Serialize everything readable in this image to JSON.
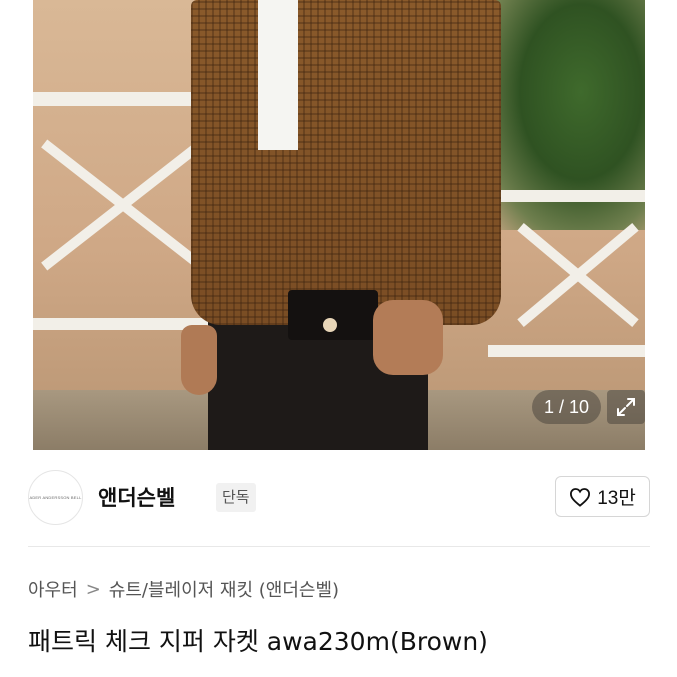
{
  "gallery": {
    "counter_text": "1 / 10",
    "expand_icon": "expand-arrows-icon"
  },
  "brand": {
    "logo_text": "ADER ANDERSSON BELL",
    "name": "앤더슨벨",
    "badge": "단독"
  },
  "like": {
    "icon": "heart-outline-icon",
    "count": "13만"
  },
  "breadcrumb": {
    "category": "아우터",
    "separator": ">",
    "subcategory": "슈트/블레이저 재킷 (앤더슨벨)"
  },
  "product": {
    "title": "패트릭 체크 지퍼 자켓 awa230m(Brown)"
  }
}
